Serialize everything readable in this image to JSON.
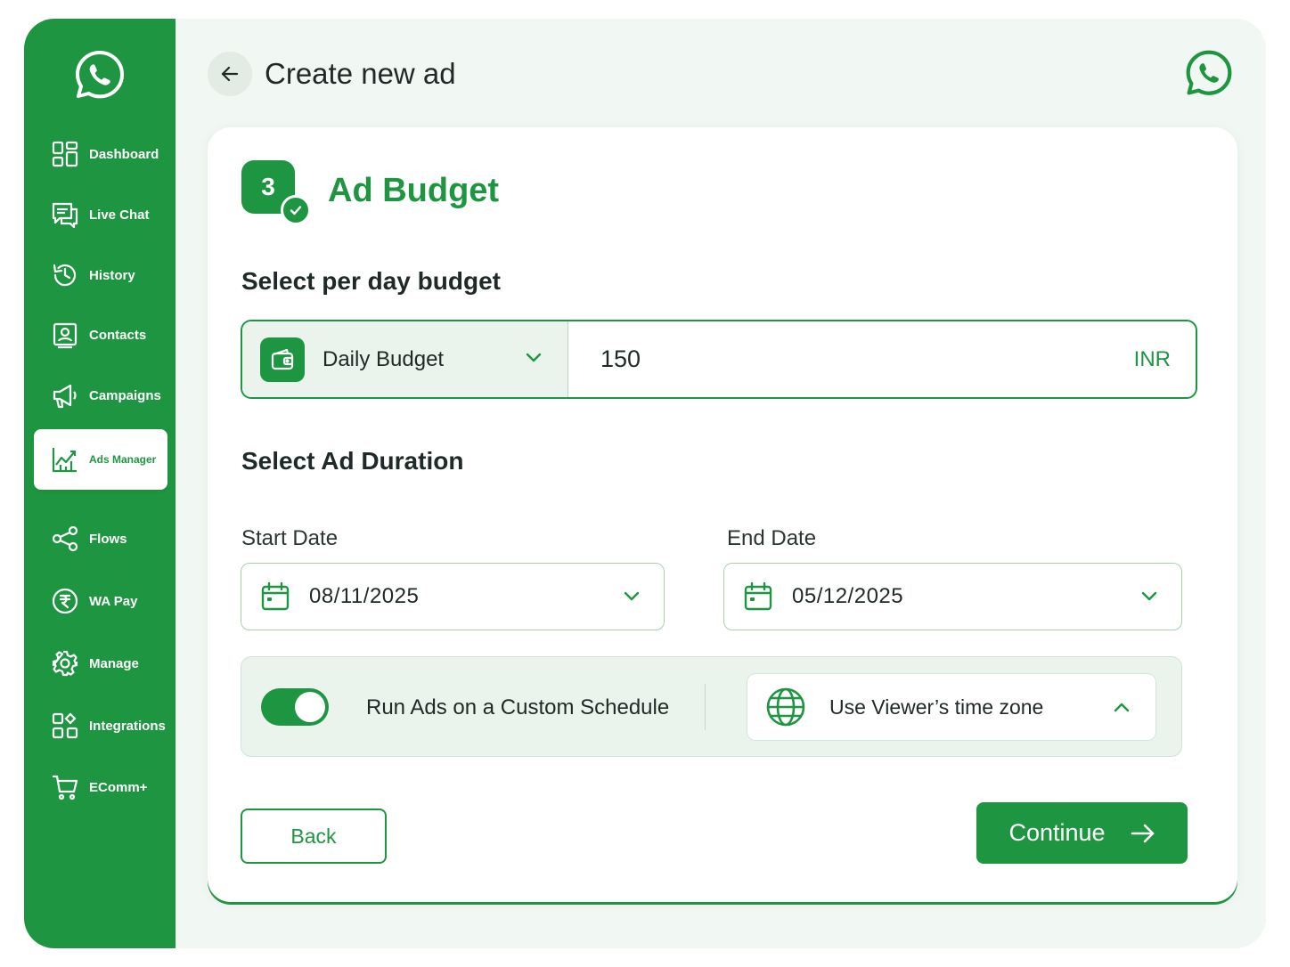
{
  "app": {
    "brand_color": "#1e9641",
    "background": "#f1f7f2"
  },
  "sidebar": {
    "logo_icon": "whatsapp-logo-icon",
    "items": [
      {
        "label": "Dashboard",
        "icon": "grid-icon",
        "active": false
      },
      {
        "label": "Live Chat",
        "icon": "chat-icon",
        "active": false
      },
      {
        "label": "History",
        "icon": "history-icon",
        "active": false
      },
      {
        "label": "Contacts",
        "icon": "contact-card-icon",
        "active": false
      },
      {
        "label": "Campaigns",
        "icon": "megaphone-icon",
        "active": false
      },
      {
        "label": "Ads Manager",
        "icon": "chart-growth-icon",
        "active": true
      },
      {
        "label": "Flows",
        "icon": "share-nodes-icon",
        "active": false
      },
      {
        "label": "WA Pay",
        "icon": "rupee-icon",
        "active": false
      },
      {
        "label": "Manage",
        "icon": "gear-icon",
        "active": false
      },
      {
        "label": "Integrations",
        "icon": "puzzle-icon",
        "active": false
      },
      {
        "label": "EComm+",
        "icon": "cart-icon",
        "active": false
      }
    ]
  },
  "header": {
    "back_icon": "arrow-left-icon",
    "title": "Create new ad",
    "logo_icon": "whatsapp-logo-icon"
  },
  "step": {
    "number": "3",
    "completed": true,
    "title": "Ad Budget"
  },
  "budget": {
    "heading": "Select per day budget",
    "type_label": "Daily Budget",
    "amount": "150",
    "currency": "INR"
  },
  "duration": {
    "heading": "Select Ad Duration",
    "start_label": "Start Date",
    "start_value": "08/11/2025",
    "end_label": "End Date",
    "end_value": "05/12/2025"
  },
  "schedule": {
    "toggle_on": true,
    "toggle_label": "Run Ads on a Custom Schedule",
    "timezone_value": "Use Viewer’s time zone"
  },
  "actions": {
    "back_label": "Back",
    "continue_label": "Continue"
  }
}
